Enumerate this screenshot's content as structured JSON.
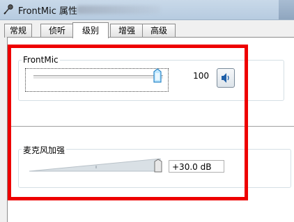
{
  "window": {
    "title": "FrontMic 属性",
    "icon": "microphone-icon"
  },
  "tabs": [
    {
      "label": "常规"
    },
    {
      "label": "侦听"
    },
    {
      "label": "级别"
    },
    {
      "label": "增强"
    },
    {
      "label": "高级"
    }
  ],
  "active_tab": "级别",
  "frontmic": {
    "label": "FrontMic",
    "level": 100,
    "level_max": 100,
    "value_text": "100",
    "mute_icon": "speaker-icon"
  },
  "boost": {
    "label": "麦克风加强",
    "value_text": "+30.0 dB",
    "level_fraction": 1.0
  },
  "highlight_color": "#ee0000",
  "accent_color": "#2a87c8"
}
